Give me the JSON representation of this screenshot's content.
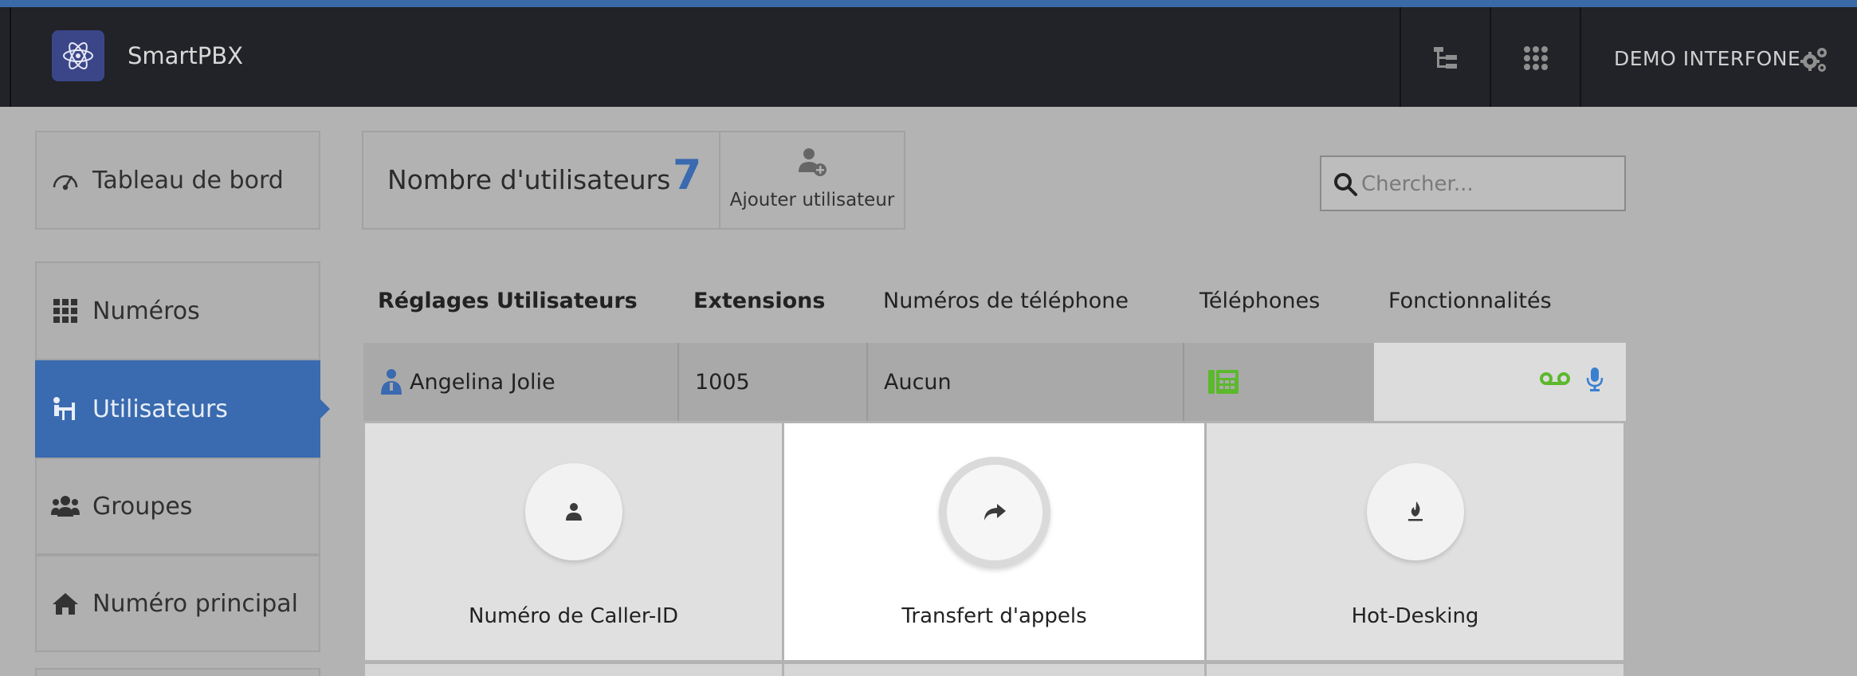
{
  "app": {
    "title": "SmartPBX"
  },
  "header": {
    "account_name": "DEMO INTERFONE"
  },
  "sidebar": {
    "items": [
      {
        "label": "Tableau de bord",
        "icon": "dashboard-icon",
        "active": false
      },
      {
        "label": "Numéros",
        "icon": "grid-icon",
        "active": false
      },
      {
        "label": "Utilisateurs",
        "icon": "users-desk-icon",
        "active": true
      },
      {
        "label": "Groupes",
        "icon": "group-icon",
        "active": false
      },
      {
        "label": "Numéro principal",
        "icon": "home-icon",
        "active": false
      }
    ]
  },
  "summary": {
    "label": "Nombre d'utilisateurs",
    "count": "7",
    "add_label": "Ajouter utilisateur"
  },
  "search": {
    "placeholder": "Chercher..."
  },
  "table": {
    "headers": [
      "Réglages Utilisateurs",
      "Extensions",
      "Numéros de téléphone",
      "Téléphones",
      "Fonctionnalités"
    ],
    "row": {
      "name": "Angelina Jolie",
      "extension": "1005",
      "phone_number": "Aucun"
    }
  },
  "features": [
    {
      "label": "Numéro de Caller-ID",
      "icon": "user-icon"
    },
    {
      "label": "Transfert d'appels",
      "icon": "share-arrow-icon",
      "selected": true
    },
    {
      "label": "Hot-Desking",
      "icon": "fire-icon"
    }
  ],
  "colors": {
    "accent": "#3a6aaf",
    "topbar": "#222328",
    "green": "#5cb82c"
  }
}
